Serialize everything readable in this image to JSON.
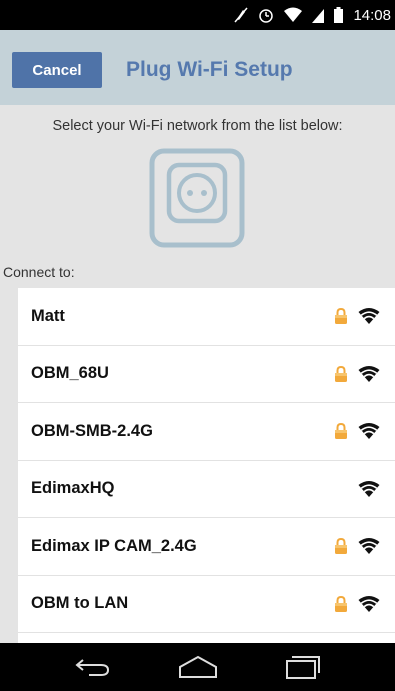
{
  "status_bar": {
    "time": "14:08",
    "icons": [
      "mute-icon",
      "alarm-icon",
      "wifi-signal-icon",
      "cell-signal-icon",
      "battery-icon"
    ]
  },
  "header": {
    "cancel_label": "Cancel",
    "title": "Plug Wi-Fi Setup"
  },
  "instruction": "Select your Wi-Fi network from the list below:",
  "plug_icon": "smart-plug-icon",
  "connect_label": "Connect to:",
  "networks": [
    {
      "name": "Matt",
      "locked": true,
      "signal": "full"
    },
    {
      "name": "OBM_68U",
      "locked": true,
      "signal": "full"
    },
    {
      "name": "OBM-SMB-2.4G",
      "locked": true,
      "signal": "strong"
    },
    {
      "name": "EdimaxHQ",
      "locked": false,
      "signal": "strong"
    },
    {
      "name": "Edimax IP CAM_2.4G",
      "locked": true,
      "signal": "strong"
    },
    {
      "name": "OBM to LAN",
      "locked": true,
      "signal": "strong"
    }
  ],
  "nav_bar": {
    "buttons": [
      "back-icon",
      "home-icon",
      "recent-apps-icon"
    ]
  },
  "colors": {
    "header_bg": "#c4d2d8",
    "accent": "#4f73a8",
    "title": "#5579ae",
    "lock": "#f2a93b"
  }
}
